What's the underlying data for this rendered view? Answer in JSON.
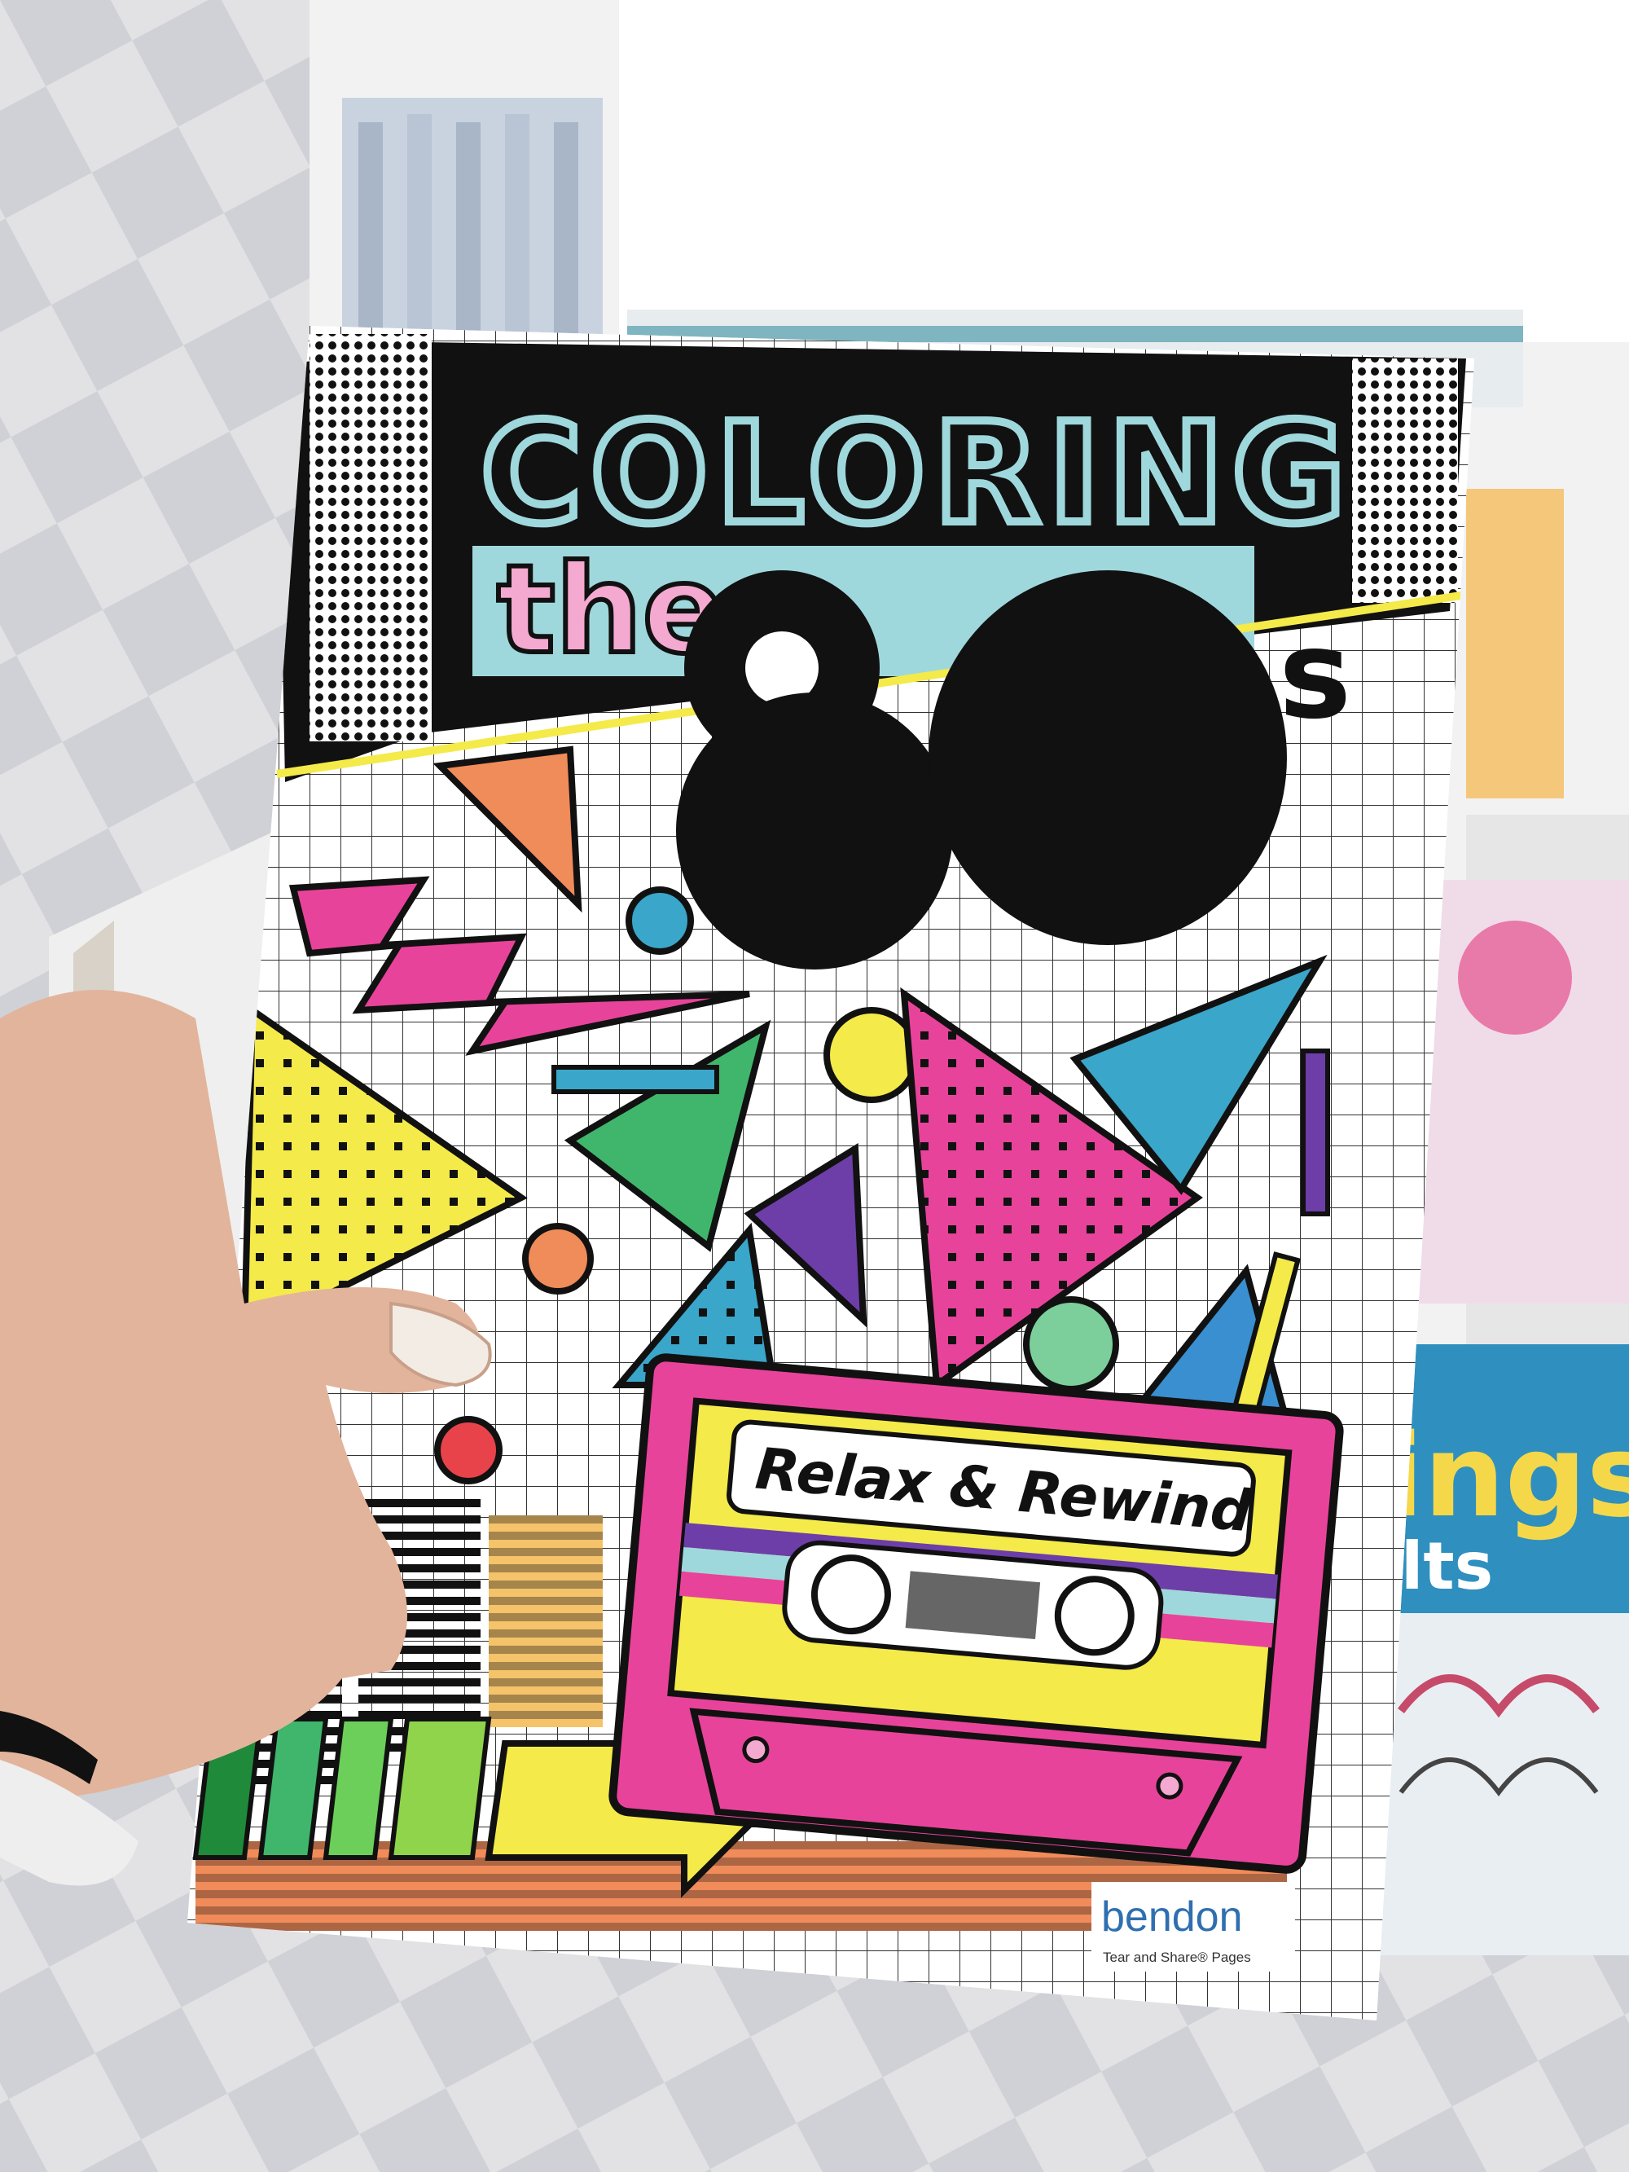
{
  "cover": {
    "title_top": "COLORING",
    "title_mid": "the",
    "title_big": "80",
    "title_suffix": "s",
    "cassette_label": "Relax & Rewind",
    "publisher": "bendon",
    "publisher_tagline": "Tear and Share® Pages"
  },
  "background_books": {
    "right_book_text_1": "ings",
    "right_book_text_2": "lts"
  },
  "colors": {
    "pink": "#e8439a",
    "teal": "#3aa6c9",
    "yellow": "#f4ea4a",
    "green": "#3fb66c",
    "purple": "#6d3ea8",
    "orange": "#f08b5a",
    "light_blue": "#9fd8dc"
  }
}
